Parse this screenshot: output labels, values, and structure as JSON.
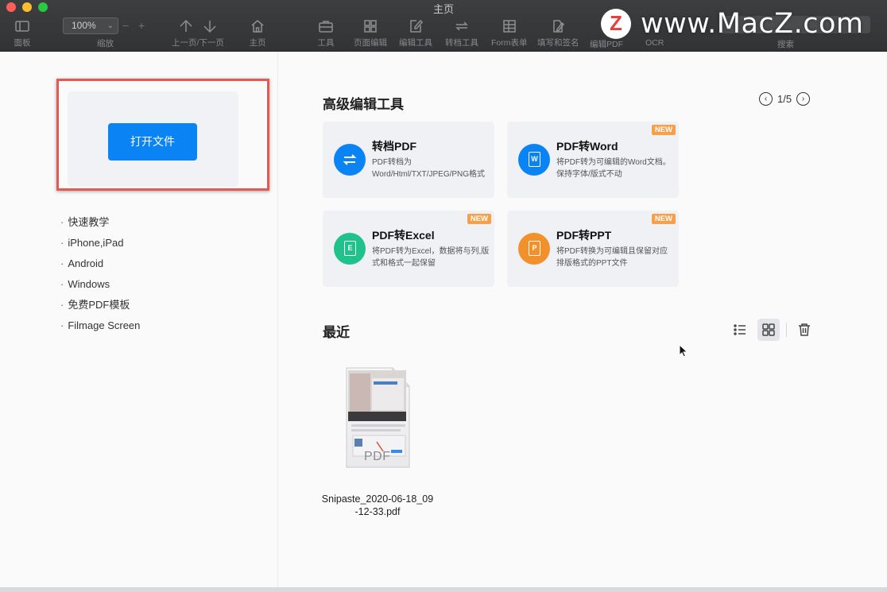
{
  "window": {
    "title": "主页"
  },
  "toolbar": {
    "panel_label": "面板",
    "zoom_value": "100%",
    "zoom_label": "缩放",
    "prev_next_label": "上一页/下一页",
    "home_label": "主页",
    "tools_label": "工具",
    "page_edit_label": "页面编辑",
    "edit_tools_label": "编辑工具",
    "convert_tools_label": "转档工具",
    "form_label": "Form表单",
    "fill_sign_label": "填写和签名",
    "edit_pdf_label": "编辑PDF",
    "ocr_label": "OCR",
    "search_label": "搜索"
  },
  "watermark": {
    "text": "www.MacZ.com"
  },
  "left": {
    "open_button": "打开文件",
    "links": [
      "快速教学",
      "iPhone,iPad",
      "Android",
      "Windows",
      "免费PDF模板",
      "Filmage Screen"
    ]
  },
  "tools_section": {
    "title": "高级编辑工具",
    "pager": "1/5",
    "cards": [
      {
        "title": "转档PDF",
        "desc": "PDF转档为Word/Html/TXT/JPEG/PNG格式",
        "badge": "",
        "color": "#0a84f5",
        "icon": "convert-icon"
      },
      {
        "title": "PDF转Word",
        "desc": "将PDF转为可编辑的Word文档。保持字体/版式不动",
        "badge": "NEW",
        "color": "#0a84f5",
        "icon": "word-icon"
      },
      {
        "title": "PDF转Excel",
        "desc": "将PDF转为Excel，数据将与列,版式和格式一起保留",
        "badge": "NEW",
        "color": "#1fc28b",
        "icon": "excel-icon"
      },
      {
        "title": "PDF转PPT",
        "desc": "将PDF转换为可编辑且保留对应排版格式的PPT文件",
        "badge": "NEW",
        "color": "#f2912b",
        "icon": "ppt-icon"
      }
    ]
  },
  "recent_section": {
    "title": "最近",
    "files": [
      {
        "name": "Snipaste_2020-06-18_09-12-33.pdf",
        "thumb_label": "PDF"
      }
    ]
  },
  "colors": {
    "accent": "#0a84f5",
    "highlight_frame": "#e35a55",
    "badge": "#f7a04b"
  }
}
